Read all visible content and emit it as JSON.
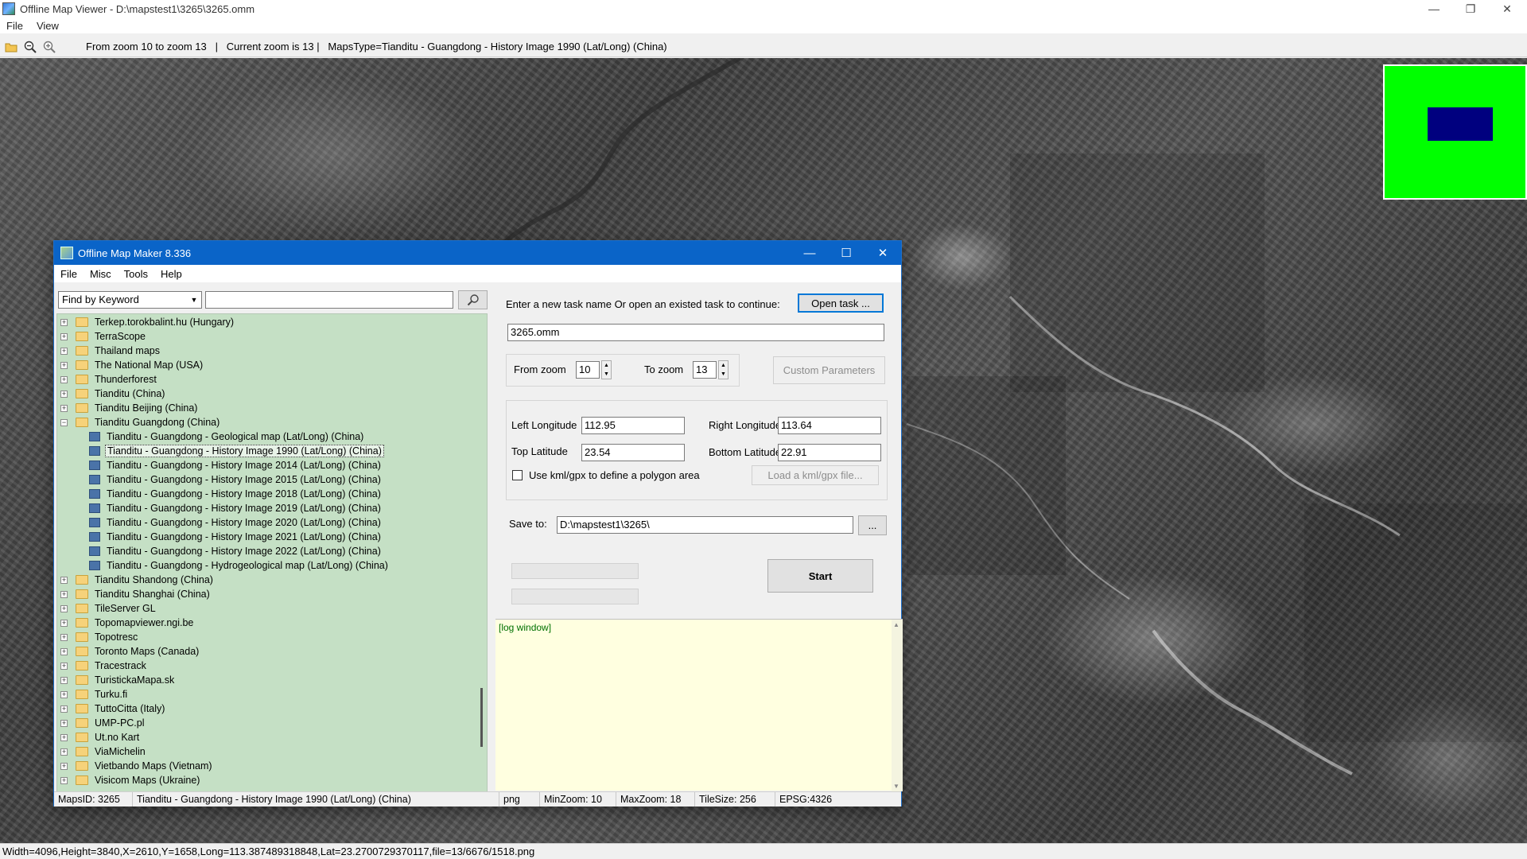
{
  "viewer": {
    "title": "Offline Map Viewer - D:\\mapstest1\\3265\\3265.omm",
    "menu": [
      "File",
      "View"
    ],
    "toolbar_text": "From zoom 10 to zoom 13   |   Current zoom is 13 |   MapsType=Tianditu - Guangdong - History Image 1990 (Lat/Long) (China)",
    "status": "Width=4096,Height=3840,X=2610,Y=1658,Long=113.387489318848,Lat=23.2700729370117,file=13/6676/1518.png"
  },
  "dialog": {
    "title": "Offline Map Maker 8.336",
    "menu": [
      "File",
      "Misc",
      "Tools",
      "Help"
    ],
    "search": {
      "mode": "Find by Keyword",
      "value": "",
      "placeholder": ""
    },
    "tree": [
      {
        "label": "Terkep.torokbalint.hu (Hungary)",
        "type": "folder",
        "expanded": false
      },
      {
        "label": "TerraScope",
        "type": "folder",
        "expanded": false
      },
      {
        "label": "Thailand maps",
        "type": "folder",
        "expanded": false
      },
      {
        "label": "The National Map (USA)",
        "type": "folder",
        "expanded": false
      },
      {
        "label": "Thunderforest",
        "type": "folder",
        "expanded": false
      },
      {
        "label": "Tianditu (China)",
        "type": "folder",
        "expanded": false
      },
      {
        "label": "Tianditu Beijing (China)",
        "type": "folder",
        "expanded": false
      },
      {
        "label": "Tianditu Guangdong (China)",
        "type": "folder",
        "expanded": true
      },
      {
        "label": "Tianditu - Guangdong - Geological map (Lat/Long) (China)",
        "type": "map"
      },
      {
        "label": "Tianditu - Guangdong - History Image 1990 (Lat/Long) (China)",
        "type": "map",
        "selected": true
      },
      {
        "label": "Tianditu - Guangdong - History Image 2014 (Lat/Long) (China)",
        "type": "map"
      },
      {
        "label": "Tianditu - Guangdong - History Image 2015 (Lat/Long) (China)",
        "type": "map"
      },
      {
        "label": "Tianditu - Guangdong - History Image 2018 (Lat/Long) (China)",
        "type": "map"
      },
      {
        "label": "Tianditu - Guangdong - History Image 2019 (Lat/Long) (China)",
        "type": "map"
      },
      {
        "label": "Tianditu - Guangdong - History Image 2020 (Lat/Long) (China)",
        "type": "map"
      },
      {
        "label": "Tianditu - Guangdong - History Image 2021 (Lat/Long) (China)",
        "type": "map"
      },
      {
        "label": "Tianditu - Guangdong - History Image 2022 (Lat/Long) (China)",
        "type": "map"
      },
      {
        "label": "Tianditu - Guangdong - Hydrogeological map (Lat/Long) (China)",
        "type": "map"
      },
      {
        "label": "Tianditu Shandong (China)",
        "type": "folder",
        "expanded": false
      },
      {
        "label": "Tianditu Shanghai (China)",
        "type": "folder",
        "expanded": false
      },
      {
        "label": "TileServer GL",
        "type": "folder",
        "expanded": false
      },
      {
        "label": "Topomapviewer.ngi.be",
        "type": "folder",
        "expanded": false
      },
      {
        "label": "Topotresc",
        "type": "folder",
        "expanded": false
      },
      {
        "label": "Toronto Maps (Canada)",
        "type": "folder",
        "expanded": false
      },
      {
        "label": "Tracestrack",
        "type": "folder",
        "expanded": false
      },
      {
        "label": "TuristickaMapa.sk",
        "type": "folder",
        "expanded": false
      },
      {
        "label": "Turku.fi",
        "type": "folder",
        "expanded": false
      },
      {
        "label": "TuttoCitta (Italy)",
        "type": "folder",
        "expanded": false
      },
      {
        "label": "UMP-PC.pl",
        "type": "folder",
        "expanded": false
      },
      {
        "label": "Ut.no Kart",
        "type": "folder",
        "expanded": false
      },
      {
        "label": "ViaMichelin",
        "type": "folder",
        "expanded": false
      },
      {
        "label": "Vietbando Maps (Vietnam)",
        "type": "folder",
        "expanded": false
      },
      {
        "label": "Visicom Maps (Ukraine)",
        "type": "folder",
        "expanded": false
      }
    ],
    "task": {
      "prompt": "Enter a new task name Or open an existed task to continue:",
      "open_label": "Open task ...",
      "name": "3265.omm",
      "from_zoom_label": "From zoom",
      "from_zoom": "10",
      "to_zoom_label": "To zoom",
      "to_zoom": "13",
      "custom_label": "Custom Parameters",
      "left_lon_label": "Left Longitude",
      "left_lon": "112.95",
      "right_lon_label": "Right Longitude",
      "right_lon": "113.64",
      "top_lat_label": "Top Latitude",
      "top_lat": "23.54",
      "bottom_lat_label": "Bottom Latitude",
      "bottom_lat": "22.91",
      "kml_label": "Use kml/gpx to define a polygon area",
      "kml_checked": false,
      "load_kml_label": "Load a kml/gpx file...",
      "save_label": "Save to:",
      "save_path": "D:\\mapstest1\\3265\\",
      "browse_label": "...",
      "start_label": "Start",
      "log_text": "[log window]"
    },
    "status": {
      "maps_id": "MapsID: 3265",
      "name": "Tianditu - Guangdong - History Image 1990 (Lat/Long) (China)",
      "format": "png",
      "min_zoom": "MinZoom: 10",
      "max_zoom": "MaxZoom: 18",
      "tile_size": "TileSize: 256",
      "epsg": "EPSG:4326"
    }
  },
  "colors": {
    "dialog_titlebar": "#0a64c8",
    "tree_background": "#c5e0c5",
    "log_background": "#ffffe0",
    "overview_background": "#00ff00",
    "overview_viewport": "#00007f"
  }
}
